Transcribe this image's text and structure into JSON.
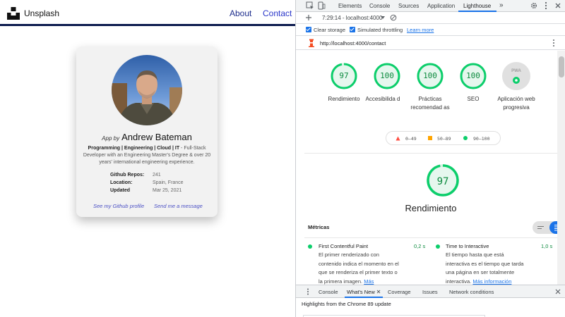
{
  "site": {
    "brand": "Unsplash",
    "nav": {
      "about": "About",
      "contact": "Contact"
    },
    "card": {
      "app_by": "App by",
      "name": "Andrew Bateman",
      "bio_bold": "Programming | Engineering | Cloud | IT",
      "bio_rest": " - Full-Stack Developer with an Engineering Master's Degree & over 20 years' international engineering experience.",
      "stats": [
        {
          "label": "Github Repos:",
          "value": "241"
        },
        {
          "label": "Location:",
          "value": "Spain, France"
        },
        {
          "label": "Updated",
          "value": "Mar 25, 2021"
        }
      ],
      "link_github": "See my Github profile",
      "link_message": "Send me a message"
    }
  },
  "devtools": {
    "tabs": [
      "Elements",
      "Console",
      "Sources",
      "Application",
      "Lighthouse"
    ],
    "more_tabs": "»",
    "session": "7:29:14 - localhost:4000",
    "options": {
      "clear_storage": "Clear storage",
      "throttling": "Simulated throttling",
      "learn_more": "Learn more"
    },
    "url": "http://localhost:4000/contact",
    "scores": [
      {
        "value": "97",
        "score": 0.97,
        "label": "Rendimiento"
      },
      {
        "value": "100",
        "score": 1.0,
        "label": "Accesibilida d"
      },
      {
        "value": "100",
        "score": 1.0,
        "label": "Prácticas recomendad as"
      },
      {
        "value": "100",
        "score": 1.0,
        "label": "SEO"
      }
    ],
    "pwa": {
      "badge": "PWA",
      "label": "Aplicación web progresiva"
    },
    "legend": {
      "red": "0–49",
      "orange": "50–89",
      "green": "90–100"
    },
    "perf": {
      "value": "97",
      "score": 0.97,
      "title": "Rendimiento"
    },
    "metrics_title": "Métricas",
    "metrics": [
      {
        "name": "First Contentful Paint",
        "value": "0,2 s",
        "desc": [
          "El primer renderizado con",
          "contenido indica el momento en el",
          "que se renderiza el primer texto o",
          "la primera imagen."
        ],
        "link": "Más"
      },
      {
        "name": "Time to Interactive",
        "value": "1,0 s",
        "desc": [
          "El tiempo hasta que está",
          "interactiva es el tiempo que tarda",
          "una página en ser totalmente",
          "interactiva."
        ],
        "link": "Más información"
      }
    ],
    "drawer": {
      "tabs": [
        "Console",
        "What's New",
        "Coverage",
        "Issues",
        "Network conditions"
      ],
      "content": "Highlights from the Chrome 89 update"
    },
    "colors": {
      "pass": "#0cce6b",
      "pass_text": "#0c8a3e",
      "accent": "#1a73e8",
      "nav_bar": "#0b1a4d"
    }
  }
}
